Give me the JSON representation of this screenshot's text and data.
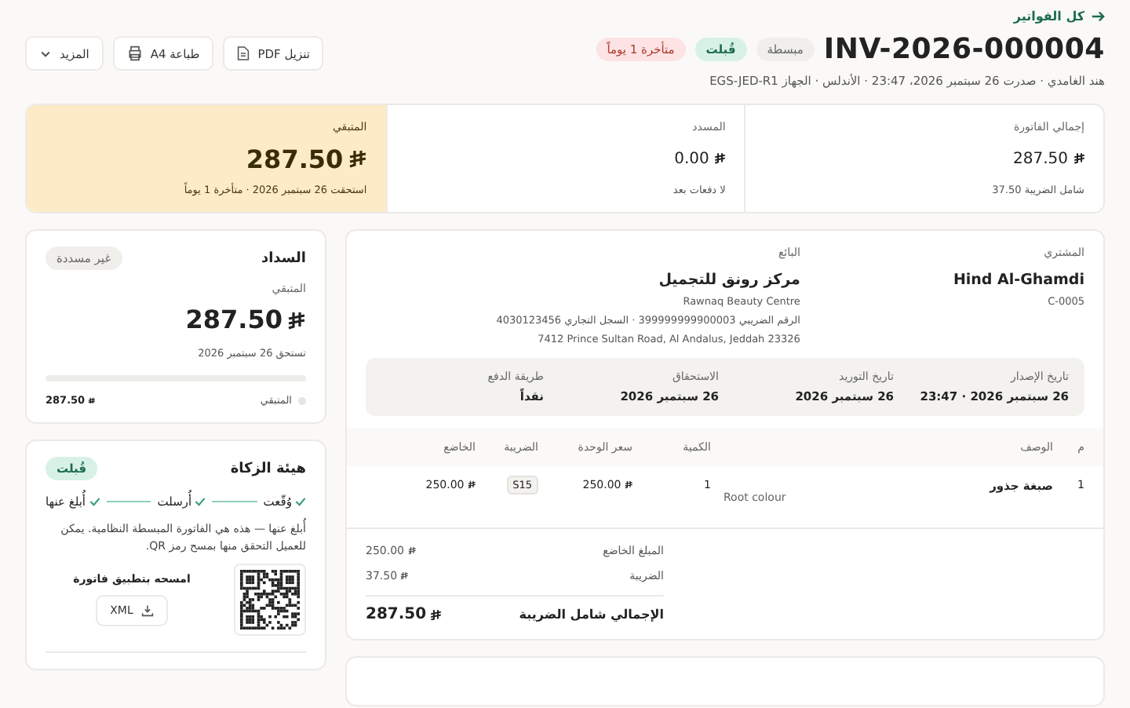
{
  "back_link": "كل الفواتير",
  "header": {
    "title": "INV-2026-000004",
    "badges": [
      {
        "label": "مبسطة",
        "kind": "neutral"
      },
      {
        "label": "قُبلت",
        "kind": "success"
      },
      {
        "label": "متأخرة 1 يوماً",
        "kind": "danger"
      }
    ],
    "subtitle": "هند الغامدي · صدرت 26 سبتمبر 2026، 23:47 · الأندلس · الجهاز EGS-JED-R1",
    "actions": [
      {
        "label": "تنزيل PDF",
        "kind": "download"
      },
      {
        "label": "طباعة A4",
        "kind": "print"
      },
      {
        "label": "المزيد",
        "kind": "dropdown"
      }
    ]
  },
  "summary": [
    {
      "label": "إجمالي الفاتورة",
      "amount": "287.50",
      "note": "شامل الضريبة 37.50",
      "highlight": false
    },
    {
      "label": "المسدد",
      "amount": "0.00",
      "note": "لا دفعات بعد",
      "highlight": false
    },
    {
      "label": "المتبقي",
      "amount": "287.50",
      "note": "استحقت 26 سبتمبر 2026 · متأخرة 1 يوماً",
      "highlight": true
    }
  ],
  "invoice": {
    "buyer": {
      "label": "المشتري",
      "name": "Hind Al-Ghamdi",
      "code": "C-0005"
    },
    "seller": {
      "label": "البائع",
      "name": "مركز رونق للتجميل",
      "latin_name": "Rawnaq Beauty Centre",
      "ids": "الرقم الضريبي 399999999900003 · السجل التجاري 4030123456",
      "address": "7412 Prince Sultan Road, Al Andalus, Jeddah 23326"
    },
    "dates": [
      {
        "label": "تاريخ الإصدار",
        "value": "26 سبتمبر 2026 · 23:47"
      },
      {
        "label": "تاريخ التوريد",
        "value": "26 سبتمبر 2026"
      },
      {
        "label": "الاستحقاق",
        "value": "26 سبتمبر 2026"
      },
      {
        "label": "طريقة الدفع",
        "value": "نقداً"
      }
    ],
    "table": {
      "columns": [
        "م",
        "الوصف",
        "الكمية",
        "سعر الوحدة",
        "الضريبة",
        "الخاضع"
      ],
      "rows": [
        {
          "index": "1",
          "name": "صبغة جذور",
          "note": "Root colour",
          "qty": "1",
          "unit_price": "250.00",
          "tax_code": "S15",
          "taxable": "250.00"
        }
      ]
    },
    "totals": [
      {
        "label": "المبلغ الخاضع",
        "amount": "250.00",
        "kind": "line"
      },
      {
        "label": "الضريبة",
        "amount": "37.50",
        "kind": "line"
      },
      {
        "label": "الإجمالي شامل الضريبة",
        "amount": "287.50",
        "kind": "grand"
      }
    ]
  },
  "payment": {
    "title": "السداد",
    "status": "غير مسددة",
    "remaining_label": "المتبقي",
    "amount": "287.50",
    "due": "تستحق 26 سبتمبر 2026",
    "level": 0,
    "legend": {
      "label": "المتبقي",
      "amount": "287.50"
    }
  },
  "zatca": {
    "title": "هيئة الزكاة",
    "status": "قُبلت",
    "steps": [
      {
        "label": "وُقّعت",
        "done": true
      },
      {
        "label": "أُرسلت",
        "done": true
      },
      {
        "label": "أُبلغ عنها",
        "done": true
      }
    ],
    "message": "أُبلغ عنها — هذه هي الفاتورة المبسطة النظامية. يمكن للعميل التحقق منها بمسح رمز QR.",
    "scan_label": "امسحه بتطبيق فاتورة",
    "download": "XML"
  }
}
